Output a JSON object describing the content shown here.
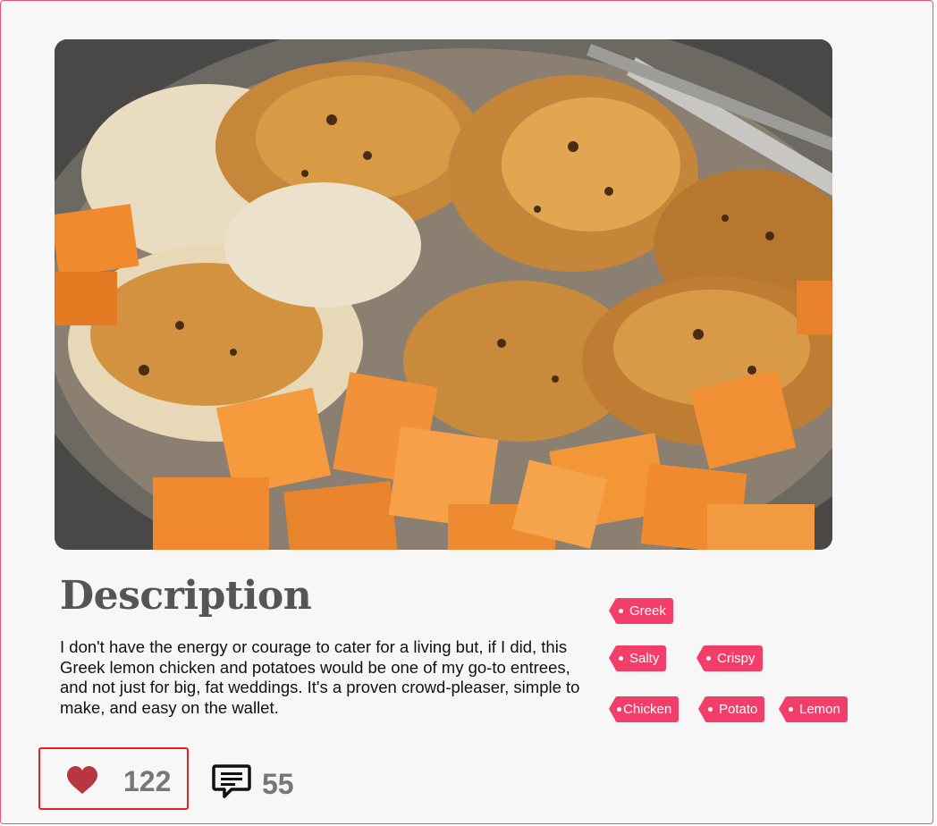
{
  "photo": {
    "subject": "Greek lemon chicken and potatoes"
  },
  "description": {
    "title": "Description",
    "body": "I don't have the energy or courage to cater for a living but, if I did, this Greek lemon chicken and potatoes would be one of my go-to entrees, and not just for big, fat weddings. It's a proven crowd-pleaser, simple to make, and easy on the wallet."
  },
  "tags": [
    "Greek",
    "Salty",
    "Crispy",
    "Chicken",
    "Potato",
    "Lemon"
  ],
  "stats": {
    "likes": "122",
    "comments": "55"
  },
  "colors": {
    "tag": "#f43e6a",
    "heart": "#b8363f",
    "highlight_border": "#e8231c",
    "count_text": "#777777",
    "card_border": "#f0546b"
  },
  "icons": {
    "like": "heart-icon",
    "comment": "comment-icon"
  }
}
